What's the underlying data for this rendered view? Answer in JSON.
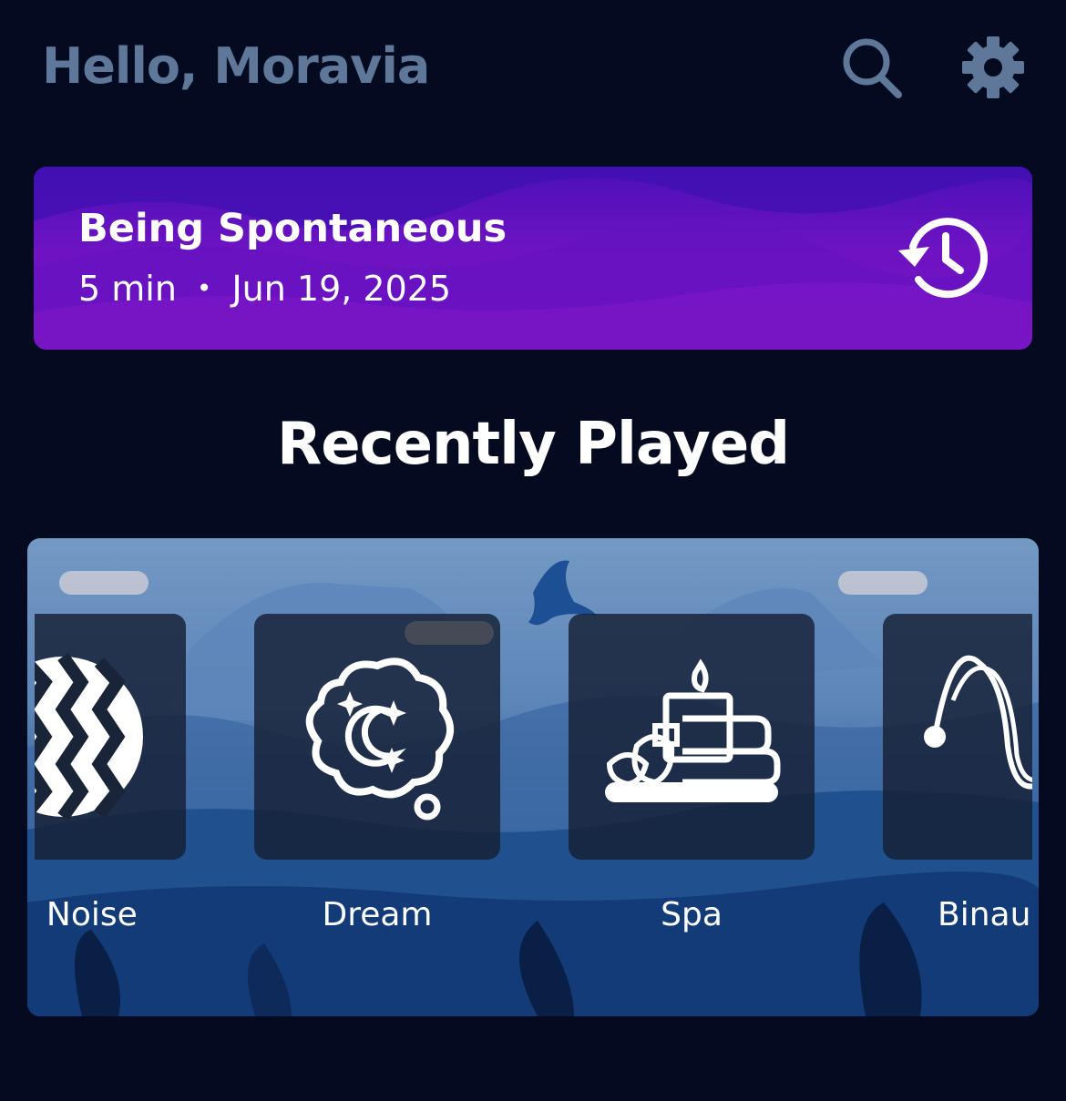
{
  "header": {
    "greeting": "Hello, Moravia",
    "search_icon": "search-icon",
    "settings_icon": "gear-icon"
  },
  "last_session": {
    "title": "Being Spontaneous",
    "duration": "5 min",
    "separator": "•",
    "date": "Jun 19, 2025",
    "icon": "history-icon"
  },
  "recently_played": {
    "title": "Recently Played",
    "items": [
      {
        "label": "wn Noise",
        "icon": "noise-wave-icon"
      },
      {
        "label": "Dream",
        "icon": "dream-cloud-icon"
      },
      {
        "label": "Spa",
        "icon": "spa-candle-icon"
      },
      {
        "label": "Binau",
        "icon": "binaural-wave-icon"
      }
    ]
  },
  "colors": {
    "background": "#040a1f",
    "greeting": "#5f789a",
    "card_purple": "#7a14c4"
  }
}
